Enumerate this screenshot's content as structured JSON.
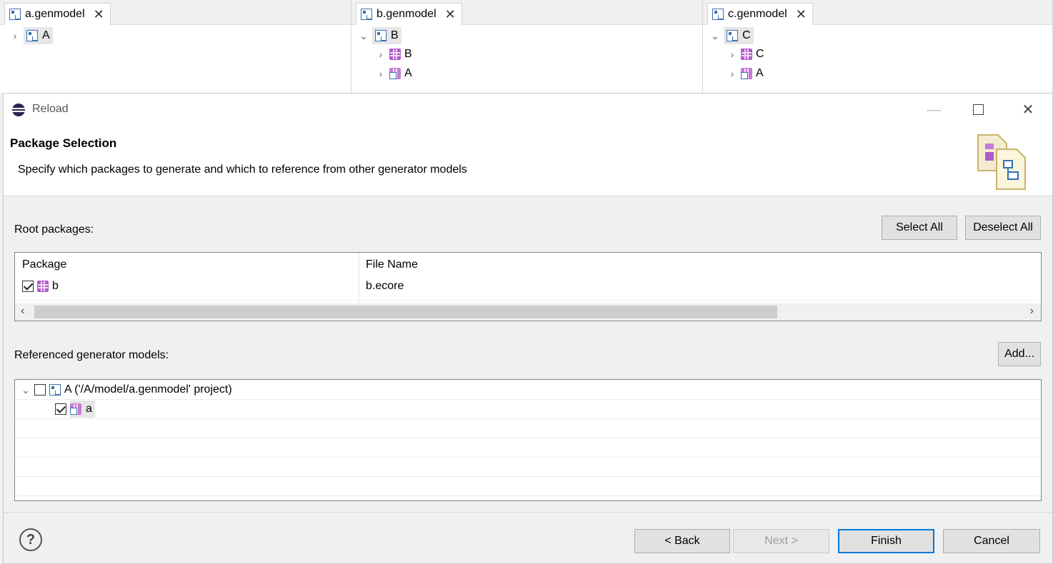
{
  "editors": [
    {
      "tab": "a.genmodel",
      "root": "A",
      "children": []
    },
    {
      "tab": "b.genmodel",
      "root": "B",
      "children": [
        "B",
        "A"
      ]
    },
    {
      "tab": "c.genmodel",
      "root": "C",
      "children": [
        "C",
        "A"
      ]
    }
  ],
  "dialog": {
    "title": "Reload",
    "header": {
      "title": "Package Selection",
      "description": "Specify which packages to generate and which to reference from other generator models"
    },
    "root_packages": {
      "label": "Root packages:",
      "select_all": "Select All",
      "deselect_all": "Deselect All",
      "columns": [
        "Package",
        "File Name"
      ],
      "rows": [
        {
          "package": "b",
          "file": "b.ecore",
          "checked": true
        }
      ]
    },
    "referenced": {
      "label": "Referenced generator models:",
      "add": "Add...",
      "root": {
        "label": "A ('/A/model/a.genmodel' project)",
        "checked": false
      },
      "child": {
        "label": "a",
        "checked": true
      }
    },
    "footer": {
      "help": "?",
      "back": "< Back",
      "next": "Next >",
      "finish": "Finish",
      "cancel": "Cancel"
    }
  },
  "colors": {
    "accent": "#0078d7",
    "package": "#b05ac8",
    "genmodel": "#3a6fb0"
  }
}
